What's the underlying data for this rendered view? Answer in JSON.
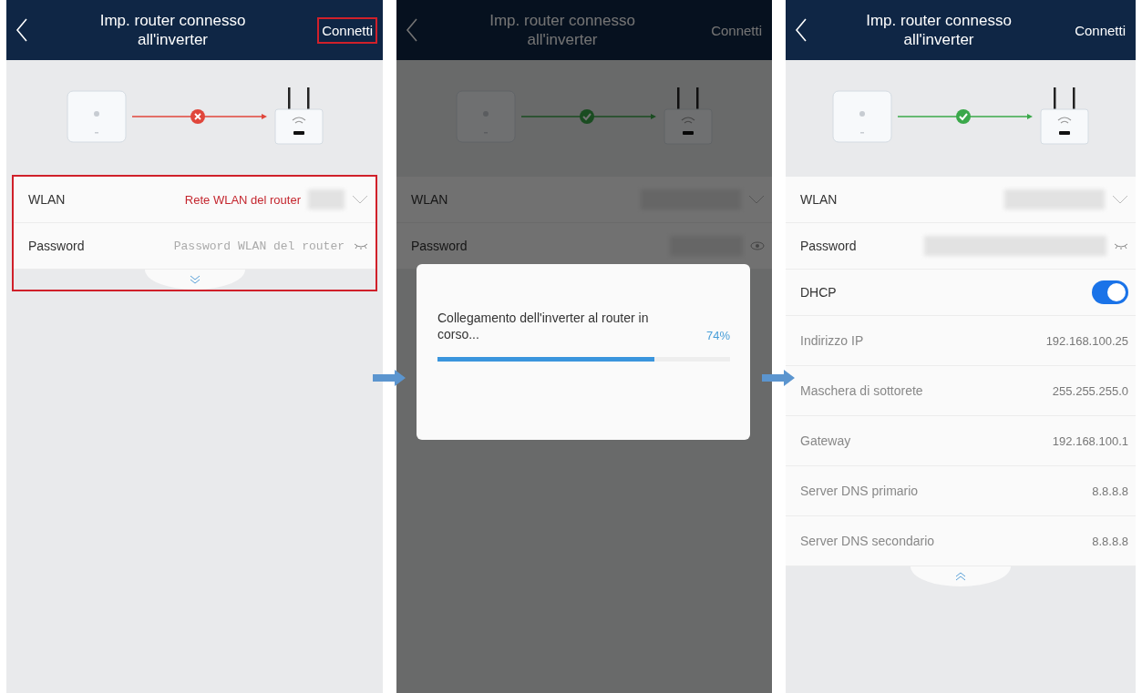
{
  "screens": [
    {
      "header": {
        "title": "Imp. router connesso all'inverter",
        "action": "Connetti",
        "action_highlighted": true
      },
      "link": {
        "connected": false
      },
      "dimmed": false,
      "fields_highlighted": true,
      "expanded": false,
      "fields": [
        {
          "kind": "select",
          "label": "WLAN",
          "value": "Rete WLAN del router"
        },
        {
          "kind": "password",
          "label": "Password",
          "placeholder": "Password WLAN del router",
          "visible": false
        }
      ]
    },
    {
      "header": {
        "title": "Imp. router connesso all'inverter",
        "action": "Connetti",
        "action_highlighted": false
      },
      "link": {
        "connected": true
      },
      "dimmed": true,
      "fields_highlighted": false,
      "fields": [
        {
          "kind": "select",
          "label": "WLAN"
        },
        {
          "kind": "password",
          "label": "Password",
          "visible": true
        }
      ],
      "dialog": {
        "message": "Collegamento dell'inverter al router in corso...",
        "percent": "74%",
        "level": 0.74
      }
    },
    {
      "header": {
        "title": "Imp. router connesso all'inverter",
        "action": "Connetti",
        "action_highlighted": false
      },
      "link": {
        "connected": true
      },
      "dimmed": false,
      "fields_highlighted": false,
      "expanded": true,
      "fields": [
        {
          "kind": "select",
          "label": "WLAN"
        },
        {
          "kind": "password",
          "label": "Password",
          "visible": false
        },
        {
          "kind": "toggle",
          "label": "DHCP",
          "on": true
        },
        {
          "kind": "info",
          "label": "Indirizzo IP",
          "value": "192.168.100.25"
        },
        {
          "kind": "info",
          "label": "Maschera di sottorete",
          "value": "255.255.255.0"
        },
        {
          "kind": "info",
          "label": "Gateway",
          "value": "192.168.100.1"
        },
        {
          "kind": "info",
          "label": "Server DNS primario",
          "value": "8.8.8.8"
        },
        {
          "kind": "info",
          "label": "Server DNS secondario",
          "value": "8.8.8.8"
        }
      ]
    }
  ]
}
